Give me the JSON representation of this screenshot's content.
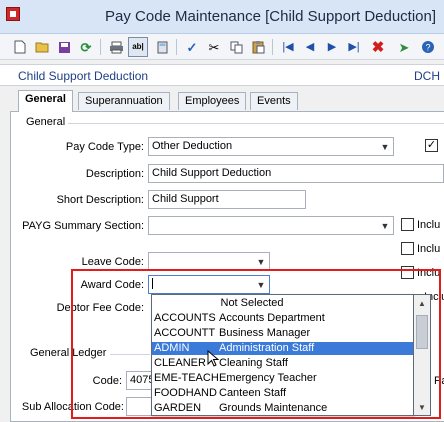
{
  "window": {
    "title": "Pay Code Maintenance  [Child Support Deduction]"
  },
  "toolbar": {
    "icons": [
      "new-document-icon",
      "open-folder-icon",
      "save-icon",
      "refresh-icon",
      "print-icon",
      "text-view-icon",
      "calculator-icon",
      "check-icon",
      "cut-icon",
      "copy-icon",
      "paste-icon",
      "first-record-icon",
      "previous-record-icon",
      "next-record-icon",
      "last-record-icon",
      "delete-icon",
      "pin-icon",
      "help-icon"
    ]
  },
  "header": {
    "record_name": "Child Support Deduction",
    "record_code": "DCH"
  },
  "tabs": [
    {
      "label": "General",
      "active": true
    },
    {
      "label": "Superannuation",
      "active": false
    },
    {
      "label": "Employees",
      "active": false
    },
    {
      "label": "Events",
      "active": false
    }
  ],
  "general": {
    "group_label": "General",
    "pay_code_type_label": "Pay Code Type:",
    "pay_code_type_value": "Other Deduction",
    "description_label": "Description:",
    "description_value": "Child Support Deduction",
    "short_description_label": "Short Description:",
    "short_description_value": "Child Support",
    "payg_label": "PAYG Summary Section:",
    "payg_value": "",
    "leave_code_label": "Leave Code:",
    "leave_code_value": "",
    "award_code_label": "Award Code:",
    "award_code_value": "",
    "debtor_fee_label": "Debtor Fee Code:",
    "checkbox_labels": [
      "Inclu",
      "Inclu",
      "Inclu",
      "Inclu"
    ]
  },
  "ledger": {
    "group_label": "General Ledger",
    "code_label": "Code:",
    "code_value": "4075",
    "sub_allocation_label": "Sub Allocation Code:",
    "right_label": "Pa"
  },
  "dropdown": {
    "not_selected": "Not Selected",
    "items": [
      {
        "code": "ACCOUNTS",
        "name": "Accounts Department",
        "selected": false
      },
      {
        "code": "ACCOUNTT",
        "name": "Business Manager",
        "selected": false
      },
      {
        "code": "ADMIN",
        "name": "Administration Staff",
        "selected": true
      },
      {
        "code": "CLEANER",
        "name": "Cleaning Staff",
        "selected": false
      },
      {
        "code": "EME-TEACH",
        "name": "Emergency Teacher",
        "selected": false
      },
      {
        "code": "FOODHAND",
        "name": "Canteen Staff",
        "selected": false
      },
      {
        "code": "GARDEN",
        "name": "Grounds Maintenance",
        "selected": false
      }
    ]
  },
  "colors": {
    "title_bar": "#d7e5f6",
    "accent_text": "#203f86",
    "selection": "#3b7ad9",
    "highlight_border": "#e31b1b"
  }
}
